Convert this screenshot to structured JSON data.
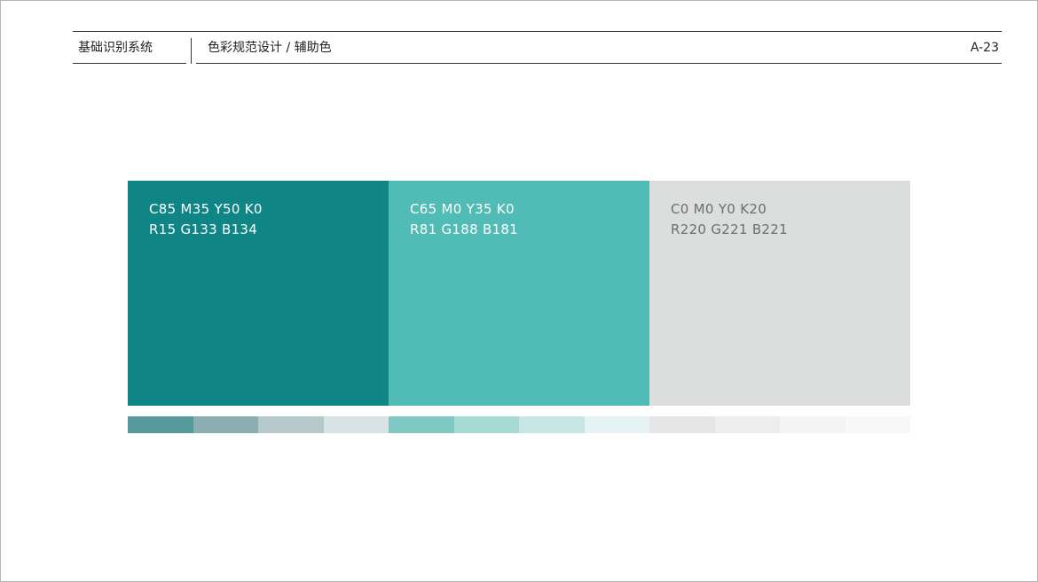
{
  "header": {
    "section": "基础识别系统",
    "title": "色彩规范设计 / 辅助色",
    "page_number": "A-23"
  },
  "swatches": [
    {
      "fill": "#0F8586",
      "text_color": "#FFFFFF",
      "cmyk": "C85  M35  Y50  K0",
      "rgb": "R15  G133  B134"
    },
    {
      "fill": "#51BCB5",
      "text_color": "#FFFFFF",
      "cmyk": "C65  M0  Y35  K0",
      "rgb": "R81  G188  B181"
    },
    {
      "fill": "#DCDDDD",
      "text_color": "#6E6E6E",
      "cmyk": "C0  M0  Y0  K20",
      "rgb": "R220  G221  B221"
    }
  ],
  "tints": [
    "#569A9C",
    "#8DAEB0",
    "#B5C8CA",
    "#DAE3E4",
    "#7FC8C3",
    "#A6D8D4",
    "#C8E7E4",
    "#E5F3F2",
    "#E6E6E6",
    "#EDEDED",
    "#F3F3F3",
    "#F8F8F8"
  ]
}
